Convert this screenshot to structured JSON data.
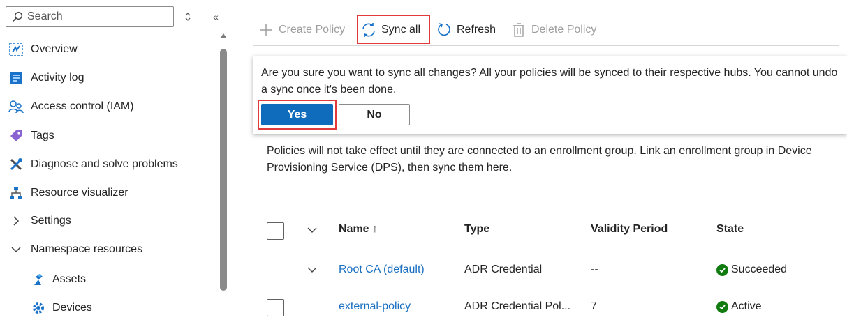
{
  "sidebar": {
    "search_placeholder": "Search",
    "collapse_label": "«",
    "items": [
      {
        "label": "Overview",
        "icon": "overview-icon"
      },
      {
        "label": "Activity log",
        "icon": "activity-log-icon"
      },
      {
        "label": "Access control (IAM)",
        "icon": "people-icon"
      },
      {
        "label": "Tags",
        "icon": "tag-icon"
      },
      {
        "label": "Diagnose and solve problems",
        "icon": "wrench-icon"
      },
      {
        "label": "Resource visualizer",
        "icon": "hierarchy-icon"
      },
      {
        "label": "Settings",
        "icon": "chevron-right-icon"
      },
      {
        "label": "Namespace resources",
        "icon": "chevron-down-icon"
      },
      {
        "label": "Assets",
        "icon": "asset-icon"
      },
      {
        "label": "Devices",
        "icon": "device-gear-icon"
      }
    ]
  },
  "toolbar": {
    "create_label": "Create Policy",
    "sync_label": "Sync all",
    "refresh_label": "Refresh",
    "delete_label": "Delete Policy"
  },
  "confirm": {
    "message": "Are you sure you want to sync all changes? All your policies will be synced to their respective hubs. You cannot undo a sync once it's been done.",
    "yes_label": "Yes",
    "no_label": "No"
  },
  "info_text": "Policies will not take effect until they are connected to an enrollment group. Link an enrollment group in Device Provisioning Service (DPS), then sync them here.",
  "table": {
    "columns": [
      "Name ↑",
      "Type",
      "Validity Period",
      "State"
    ],
    "rows": [
      {
        "name": "Root CA (default)",
        "type": "ADR Credential",
        "validity": "--",
        "state": "Succeeded"
      },
      {
        "name": "external-policy",
        "type": "ADR Credential Pol...",
        "validity": "7",
        "state": "Active"
      }
    ]
  },
  "colors": {
    "accent": "#0f6cbd",
    "highlight": "#e03a3a",
    "success": "#107c10",
    "link": "#1a6fc1"
  }
}
